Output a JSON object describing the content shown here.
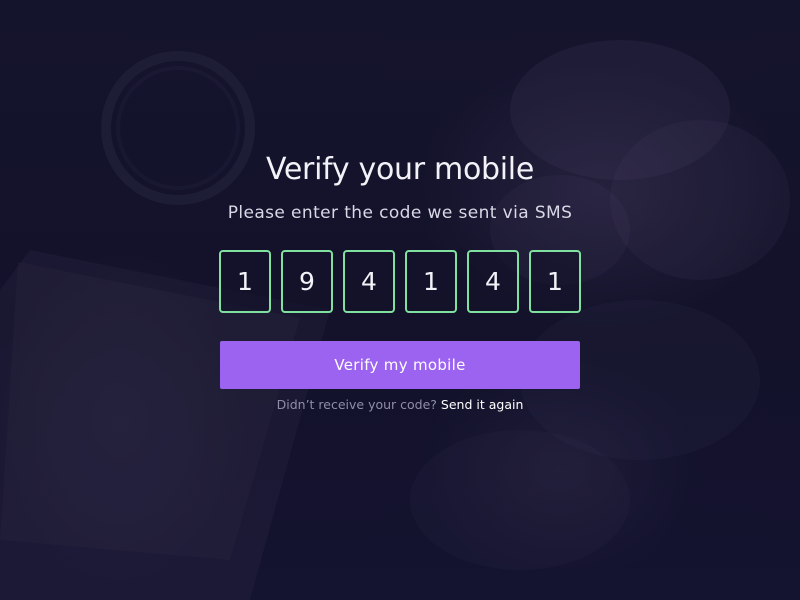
{
  "heading": "Verify your mobile",
  "instructions": "Please enter the code we sent via SMS",
  "code_digits": [
    "1",
    "9",
    "4",
    "1",
    "4",
    "1"
  ],
  "verify_button_label": "Verify my mobile",
  "resend": {
    "prompt": "Didn’t receive your code?",
    "link_label": "Send it again"
  },
  "colors": {
    "background": "#13122a",
    "accent_button": "#9c62f0",
    "digit_border": "#7fe0a0"
  }
}
